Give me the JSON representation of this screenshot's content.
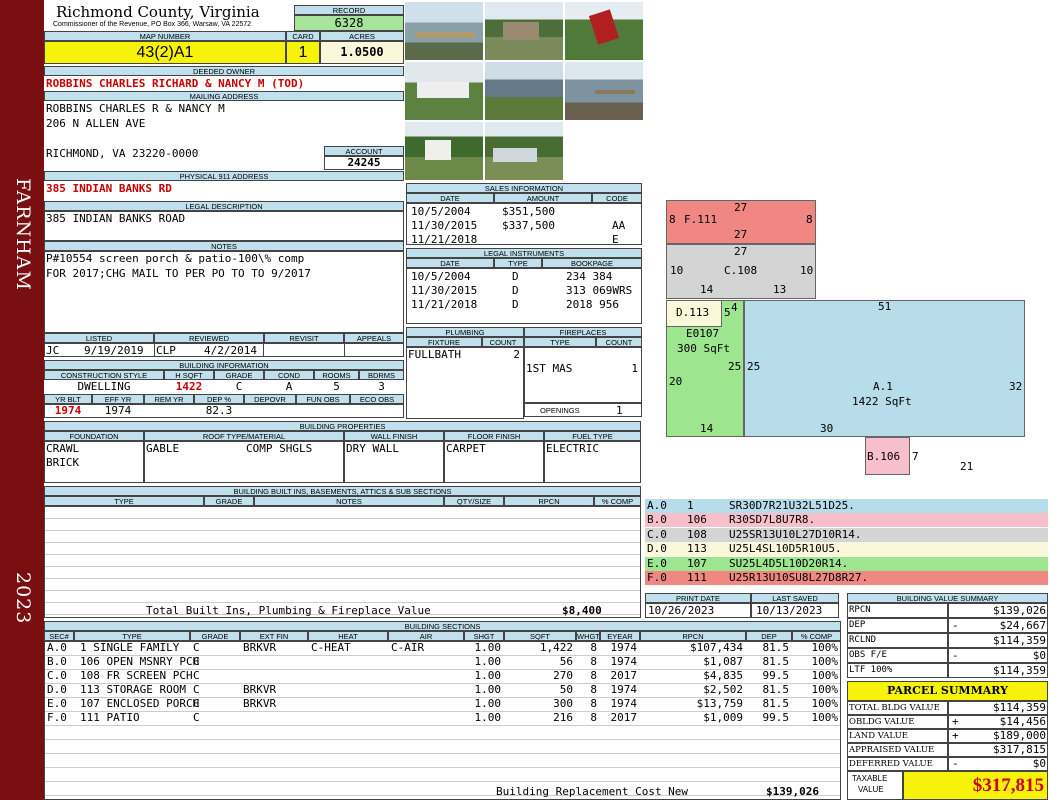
{
  "sidebar": {
    "town": "FARNHAM",
    "year": "2023"
  },
  "header": {
    "county": "Richmond County, Virginia",
    "office": "Commissioner of the Revenue, PO Box 366, Warsaw, VA 22572",
    "record_label": "RECORD",
    "record": "6328",
    "map_label": "MAP NUMBER",
    "map": "43(2)A1",
    "card_label": "CARD",
    "card": "1",
    "acres_label": "ACRES",
    "acres": "1.0500"
  },
  "owner": {
    "label": "DEEDED OWNER",
    "name": "ROBBINS CHARLES RICHARD & NANCY M (TOD)"
  },
  "mailing": {
    "label": "MAILING ADDRESS",
    "line1": "ROBBINS CHARLES R & NANCY M",
    "line2": "206 N ALLEN AVE",
    "line3": "RICHMOND, VA 23220-0000",
    "account_label": "ACCOUNT",
    "account": "24245"
  },
  "physical": {
    "label": "PHYSICAL 911 ADDRESS",
    "address": "385 INDIAN BANKS RD"
  },
  "legal": {
    "label": "LEGAL DESCRIPTION",
    "text": "385 INDIAN BANKS ROAD"
  },
  "notes": {
    "label": "NOTES",
    "line1": "P#10554 screen porch & patio-100\\% comp",
    "line2": "FOR 2017;CHG MAIL TO PER PO TO TO 9/2017"
  },
  "review": {
    "listed_label": "LISTED",
    "reviewed_label": "REVIEWED",
    "revisit_label": "REVISIT",
    "appeals_label": "APPEALS",
    "listed_by": "JC",
    "listed_date": "9/19/2019",
    "reviewed_by": "CLP",
    "reviewed_date": "4/2/2014"
  },
  "building_info": {
    "label": "BUILDING INFORMATION",
    "headers": [
      "CONSTRUCTION STYLE",
      "H SQFT",
      "GRADE",
      "COND",
      "ROOMS",
      "BDRMS"
    ],
    "style": "DWELLING",
    "hsqft": "1422",
    "grade": "C",
    "cond": "A",
    "rooms": "5",
    "bdrms": "3",
    "headers2": [
      "YR BLT",
      "EFF YR",
      "REM YR",
      "DEP %",
      "DEPOVR",
      "FUN OBS",
      "ECO OBS"
    ],
    "yr_blt": "1974",
    "eff_yr": "1974",
    "dep": "82.3"
  },
  "props": {
    "label": "BUILDING PROPERTIES",
    "headers": [
      "FOUNDATION",
      "ROOF TYPE/MATERIAL",
      "WALL FINISH",
      "FLOOR FINISH",
      "FUEL TYPE"
    ],
    "foundation1": "CRAWL",
    "foundation2": "BRICK",
    "roof_type": "GABLE",
    "roof_mat": "COMP SHGLS",
    "wall": "DRY WALL",
    "floor": "CARPET",
    "fuel": "ELECTRIC"
  },
  "builtins": {
    "label": "BUILDING BUILT INS, BASEMENTS, ATTICS & SUB SECTIONS",
    "headers": [
      "TYPE",
      "GRADE",
      "NOTES",
      "QTY/SIZE",
      "RPCN",
      "% COMP"
    ],
    "total_label": "Total Built Ins, Plumbing & Fireplace Value",
    "total": "$8,400"
  },
  "sales": {
    "label": "SALES INFORMATION",
    "headers": [
      "DATE",
      "AMOUNT",
      "CODE"
    ],
    "rows": [
      [
        "10/5/2004",
        "$351,500",
        ""
      ],
      [
        "11/30/2015",
        "$337,500",
        "AA"
      ],
      [
        "11/21/2018",
        "",
        "E"
      ]
    ]
  },
  "instruments": {
    "label": "LEGAL INSTRUMENTS",
    "headers": [
      "DATE",
      "TYPE",
      "BOOKPAGE"
    ],
    "rows": [
      [
        "10/5/2004",
        "D",
        "234 384"
      ],
      [
        "11/30/2015",
        "D",
        "313 069WRS"
      ],
      [
        "11/21/2018",
        "D",
        "2018 956"
      ]
    ]
  },
  "plumbing": {
    "label": "PLUMBING",
    "headers": [
      "FIXTURE",
      "COUNT"
    ],
    "fixture": "FULLBATH",
    "count": "2"
  },
  "fireplaces": {
    "label": "FIREPLACES",
    "headers": [
      "TYPE",
      "COUNT"
    ],
    "type": "1ST MAS",
    "count": "1",
    "openings_label": "OPENINGS",
    "openings": "1"
  },
  "sketch": {
    "a": {
      "code": "A.1",
      "area": "1422 SqFt",
      "top": "51",
      "right": "32",
      "bottom": "30",
      "left": "25"
    },
    "e": {
      "code": "E0107",
      "area": "300 SqFt",
      "left": "20",
      "bottom": "14",
      "top": "5"
    },
    "d": {
      "code": "D.113",
      "side": "4"
    },
    "c": {
      "code": "C.108",
      "top": "27",
      "left": "10",
      "right": "10",
      "bottom": "14",
      "bottom2": "13"
    },
    "f": {
      "code": "F.111",
      "top": "27",
      "bottom": "27",
      "left": "8",
      "right": "8"
    },
    "b": {
      "code": "B.106",
      "right": "7",
      "bottom": "21"
    },
    "a_left2": "25"
  },
  "legend": [
    {
      "id": "A.0",
      "num": "1",
      "desc": "SR30D7R21U32L51D25.",
      "color": "#b7dcea"
    },
    {
      "id": "B.0",
      "num": "106",
      "desc": "R30SD7L8U7R8.",
      "color": "#f7bfcb"
    },
    {
      "id": "C.0",
      "num": "108",
      "desc": "U25SR13U10L27D10R14.",
      "color": "#d4d4d4"
    },
    {
      "id": "D.0",
      "num": "113",
      "desc": "U25L4SL10D5R10U5.",
      "color": "#fbf7da"
    },
    {
      "id": "E.0",
      "num": "107",
      "desc": "SU25L4D5L10D20R14.",
      "color": "#9de58f"
    },
    {
      "id": "F.0",
      "num": "111",
      "desc": "U25R13U10SU8L27D8R27.",
      "color": "#f08783"
    }
  ],
  "dates": {
    "print_label": "PRINT DATE",
    "print": "10/26/2023",
    "saved_label": "LAST SAVED",
    "saved": "10/13/2023"
  },
  "sections": {
    "label": "BUILDING SECTIONS",
    "headers": [
      "SEC#",
      "TYPE",
      "GRADE",
      "EXT FIN",
      "HEAT",
      "AIR",
      "SHGT",
      "SQFT",
      "WHGT",
      "EYEAR",
      "RPCN",
      "DEP",
      "% COMP"
    ],
    "rows": [
      [
        "A.0",
        "1 SINGLE FAMILY",
        "C",
        "BRKVR",
        "C-HEAT",
        "C-AIR",
        "1.00",
        "1,422",
        "8",
        "1974",
        "$107,434",
        "81.5",
        "100%"
      ],
      [
        "B.0",
        "106 OPEN MSNRY PCH",
        "C",
        "",
        "",
        "",
        "1.00",
        "56",
        "8",
        "1974",
        "$1,087",
        "81.5",
        "100%"
      ],
      [
        "C.0",
        "108 FR SCREEN PCH",
        "C",
        "",
        "",
        "",
        "1.00",
        "270",
        "8",
        "2017",
        "$4,835",
        "99.5",
        "100%"
      ],
      [
        "D.0",
        "113 STORAGE ROOM",
        "C",
        "BRKVR",
        "",
        "",
        "1.00",
        "50",
        "8",
        "1974",
        "$2,502",
        "81.5",
        "100%"
      ],
      [
        "E.0",
        "107 ENCLOSED PORCH",
        "C",
        "BRKVR",
        "",
        "",
        "1.00",
        "300",
        "8",
        "1974",
        "$13,759",
        "81.5",
        "100%"
      ],
      [
        "F.0",
        "111 PATIO",
        "C",
        "",
        "",
        "",
        "1.00",
        "216",
        "8",
        "2017",
        "$1,009",
        "99.5",
        "100%"
      ]
    ],
    "total_label": "Building Replacement Cost New",
    "total": "$139,026"
  },
  "bvs": {
    "label": "BUILDING VALUE SUMMARY",
    "rows": [
      [
        "RPCN",
        "",
        "$139,026"
      ],
      [
        "DEP",
        "-",
        "$24,667"
      ],
      [
        "RCLND",
        "",
        "$114,359"
      ],
      [
        "OBS F/E",
        "-",
        "$0"
      ],
      [
        "LTF 100%",
        "",
        "$114,359"
      ]
    ]
  },
  "parcel": {
    "label": "PARCEL SUMMARY",
    "rows": [
      [
        "TOTAL BLDG VALUE",
        "",
        "$114,359"
      ],
      [
        "OBLDG VALUE",
        "+",
        "$14,456"
      ],
      [
        "LAND VALUE",
        "+",
        "$189,000"
      ],
      [
        "APPRAISED VALUE",
        "",
        "$317,815"
      ],
      [
        "DEFERRED VALUE",
        "-",
        "$0"
      ]
    ],
    "taxable_label1": "TAXABLE",
    "taxable_label2": "VALUE",
    "taxable": "$317,815"
  }
}
